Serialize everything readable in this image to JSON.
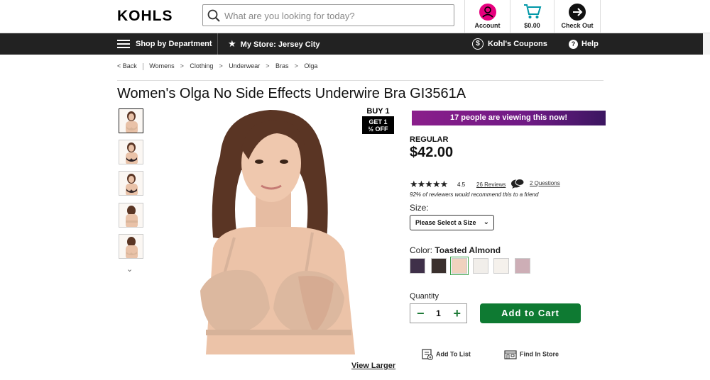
{
  "header": {
    "logo": "KOHLS",
    "search_placeholder": "What are you looking for today?",
    "account_label": "Account",
    "cart_label": "$0.00",
    "checkout_label": "Check Out"
  },
  "nav": {
    "shop_label": "Shop by Department",
    "store_label": "My Store: Jersey City",
    "coupons_label": "Kohl's Coupons",
    "help_label": "Help"
  },
  "breadcrumb": {
    "back": "< Back",
    "items": [
      "Womens",
      "Clothing",
      "Underwear",
      "Bras",
      "Olga"
    ]
  },
  "product": {
    "title": "Women's Olga No Side Effects Underwire Bra GI3561A",
    "offer_top": "BUY 1",
    "offer_line1": "GET 1",
    "offer_line2": "½ OFF",
    "view_larger": "View Larger",
    "viewing": "17 people are viewing this now!",
    "price_label": "REGULAR",
    "price": "$42.00",
    "rating": "4.5",
    "stars": "★★★★★",
    "reviews": "26 Reviews",
    "questions": "2 Questions",
    "recommend": "92% of reviewers would recommend this to a friend",
    "size_label": "Size:",
    "size_select": "Please Select a Size",
    "color_label": "Color:",
    "color_value": "Toasted Almond",
    "swatches": [
      "#3f3049",
      "#3a302d",
      "#f0d2be",
      "#f1eeea",
      "#f5f1ec",
      "#cdaeb6"
    ],
    "quantity_label": "Quantity",
    "quantity": "1",
    "qty_minus": "−",
    "qty_plus": "+",
    "add_to_cart": "Add to Cart",
    "add_to_list": "Add To List",
    "find_in_store": "Find In Store"
  },
  "colors": {
    "accent_green": "#0e7a32",
    "promo_purple": "#7b1d86",
    "account_pink": "#e6007e",
    "cart_teal": "#0097a7"
  }
}
